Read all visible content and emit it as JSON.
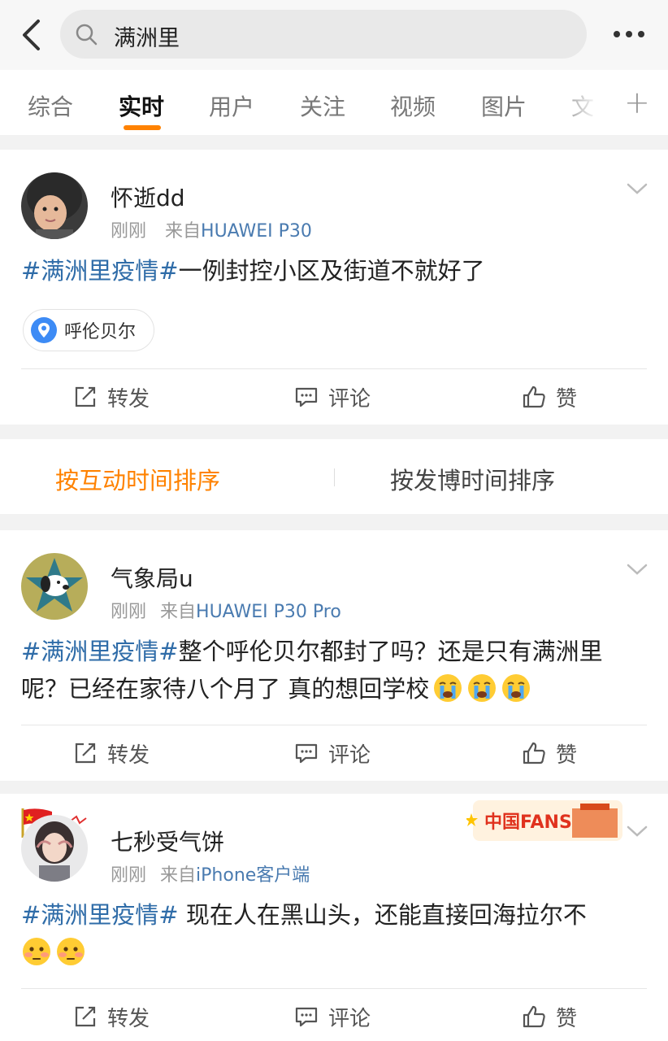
{
  "search": {
    "query": "满洲里"
  },
  "tabs": [
    {
      "label": "综合"
    },
    {
      "label": "实时"
    },
    {
      "label": "用户"
    },
    {
      "label": "关注"
    },
    {
      "label": "视频"
    },
    {
      "label": "图片"
    },
    {
      "label": "文"
    }
  ],
  "tab_plus": "+",
  "posts": [
    {
      "username": "怀逝dd",
      "time": "刚刚",
      "from_label": "来自",
      "source": "HUAWEI P30",
      "hashtag": "#满洲里疫情#",
      "text": "一例封控小区及街道不就好了",
      "location": "呼伦贝尔",
      "actions": {
        "repost": "转发",
        "comment": "评论",
        "like": "赞"
      }
    },
    {
      "username": "气象局u",
      "time": "刚刚",
      "from_label": "来自",
      "source": "HUAWEI P30 Pro",
      "hashtag": "#满洲里疫情#",
      "text": "整个呼伦贝尔都封了吗？还是只有满洲里呢？已经在家待八个月了 真的想回学校",
      "actions": {
        "repost": "转发",
        "comment": "评论",
        "like": "赞"
      }
    },
    {
      "username": "七秒受气饼",
      "time": "刚刚",
      "from_label": "来自",
      "source": "iPhone客户端",
      "hashtag": "#满洲里疫情#",
      "text": " 现在人在黑山头，还能直接回海拉尔不",
      "badge": "中国FANS",
      "actions": {
        "repost": "转发",
        "comment": "评论",
        "like": "赞"
      }
    }
  ],
  "sort": {
    "interaction": "按互动时间排序",
    "posted": "按发博时间排序"
  },
  "colors": {
    "accent": "#ff8200",
    "link": "#2f6ca8",
    "source": "#4a7bb0"
  },
  "icons": [
    "back-icon",
    "search-icon",
    "more-icon",
    "chevron-down-icon",
    "location-pin-icon",
    "repost-icon",
    "comment-icon",
    "like-icon",
    "crying-emoji-icon",
    "flushed-emoji-icon",
    "china-flag-icon"
  ]
}
